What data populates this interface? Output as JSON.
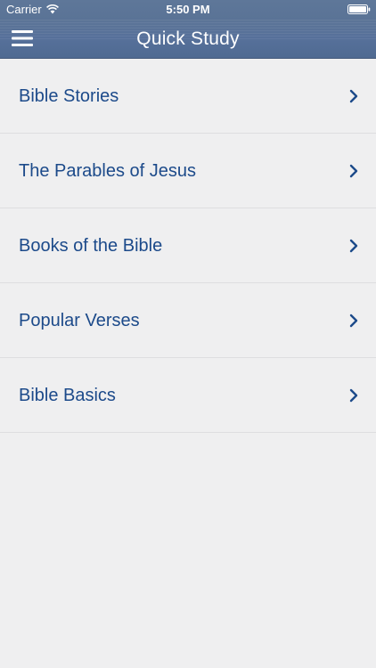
{
  "status_bar": {
    "carrier": "Carrier",
    "time": "5:50 PM"
  },
  "nav": {
    "title": "Quick Study",
    "menu_icon": "hamburger-menu-icon"
  },
  "list": {
    "items": [
      {
        "label": "Bible Stories"
      },
      {
        "label": "The Parables of Jesus"
      },
      {
        "label": "Books of the Bible"
      },
      {
        "label": "Popular Verses"
      },
      {
        "label": "Bible Basics"
      }
    ],
    "chevron_icon": "chevron-right-icon"
  },
  "colors": {
    "nav_bar": "#56709a",
    "label_text": "#1c4a8a",
    "background": "#efeff0",
    "separator": "#dedee0"
  }
}
